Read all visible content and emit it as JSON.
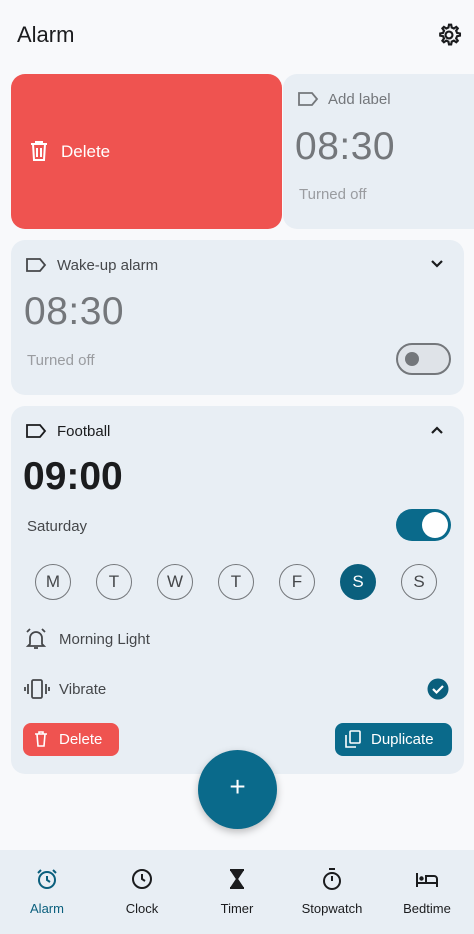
{
  "app_bar": {
    "title": "Alarm",
    "settings_icon": "gear-icon"
  },
  "swipe_action": {
    "label": "Delete",
    "icon": "trash-icon",
    "color": "#ef5350"
  },
  "swiped_alarm": {
    "label": "Add label",
    "time": "08:30",
    "status": "Turned off"
  },
  "alarm1": {
    "label": "Wake-up alarm",
    "time": "08:30",
    "status": "Turned off",
    "enabled": false,
    "expanded": false
  },
  "alarm2": {
    "label": "Football",
    "time": "09:00",
    "schedule": "Saturday",
    "enabled": true,
    "expanded": true,
    "days": [
      "M",
      "T",
      "W",
      "T",
      "F",
      "S",
      "S"
    ],
    "selected_day_index": 5,
    "sound": "Morning Light",
    "vibrate_label": "Vibrate",
    "vibrate_checked": true,
    "delete_label": "Delete",
    "duplicate_label": "Duplicate"
  },
  "fab": {
    "symbol": "+"
  },
  "nav": [
    {
      "label": "Alarm",
      "icon": "alarm-clock-icon",
      "active": true
    },
    {
      "label": "Clock",
      "icon": "clock-icon",
      "active": false
    },
    {
      "label": "Timer",
      "icon": "hourglass-icon",
      "active": false
    },
    {
      "label": "Stopwatch",
      "icon": "stopwatch-icon",
      "active": false
    },
    {
      "label": "Bedtime",
      "icon": "bed-icon",
      "active": false
    }
  ],
  "colors": {
    "accent": "#0a6a8b",
    "danger": "#ef5350",
    "card": "#e8eef4"
  }
}
